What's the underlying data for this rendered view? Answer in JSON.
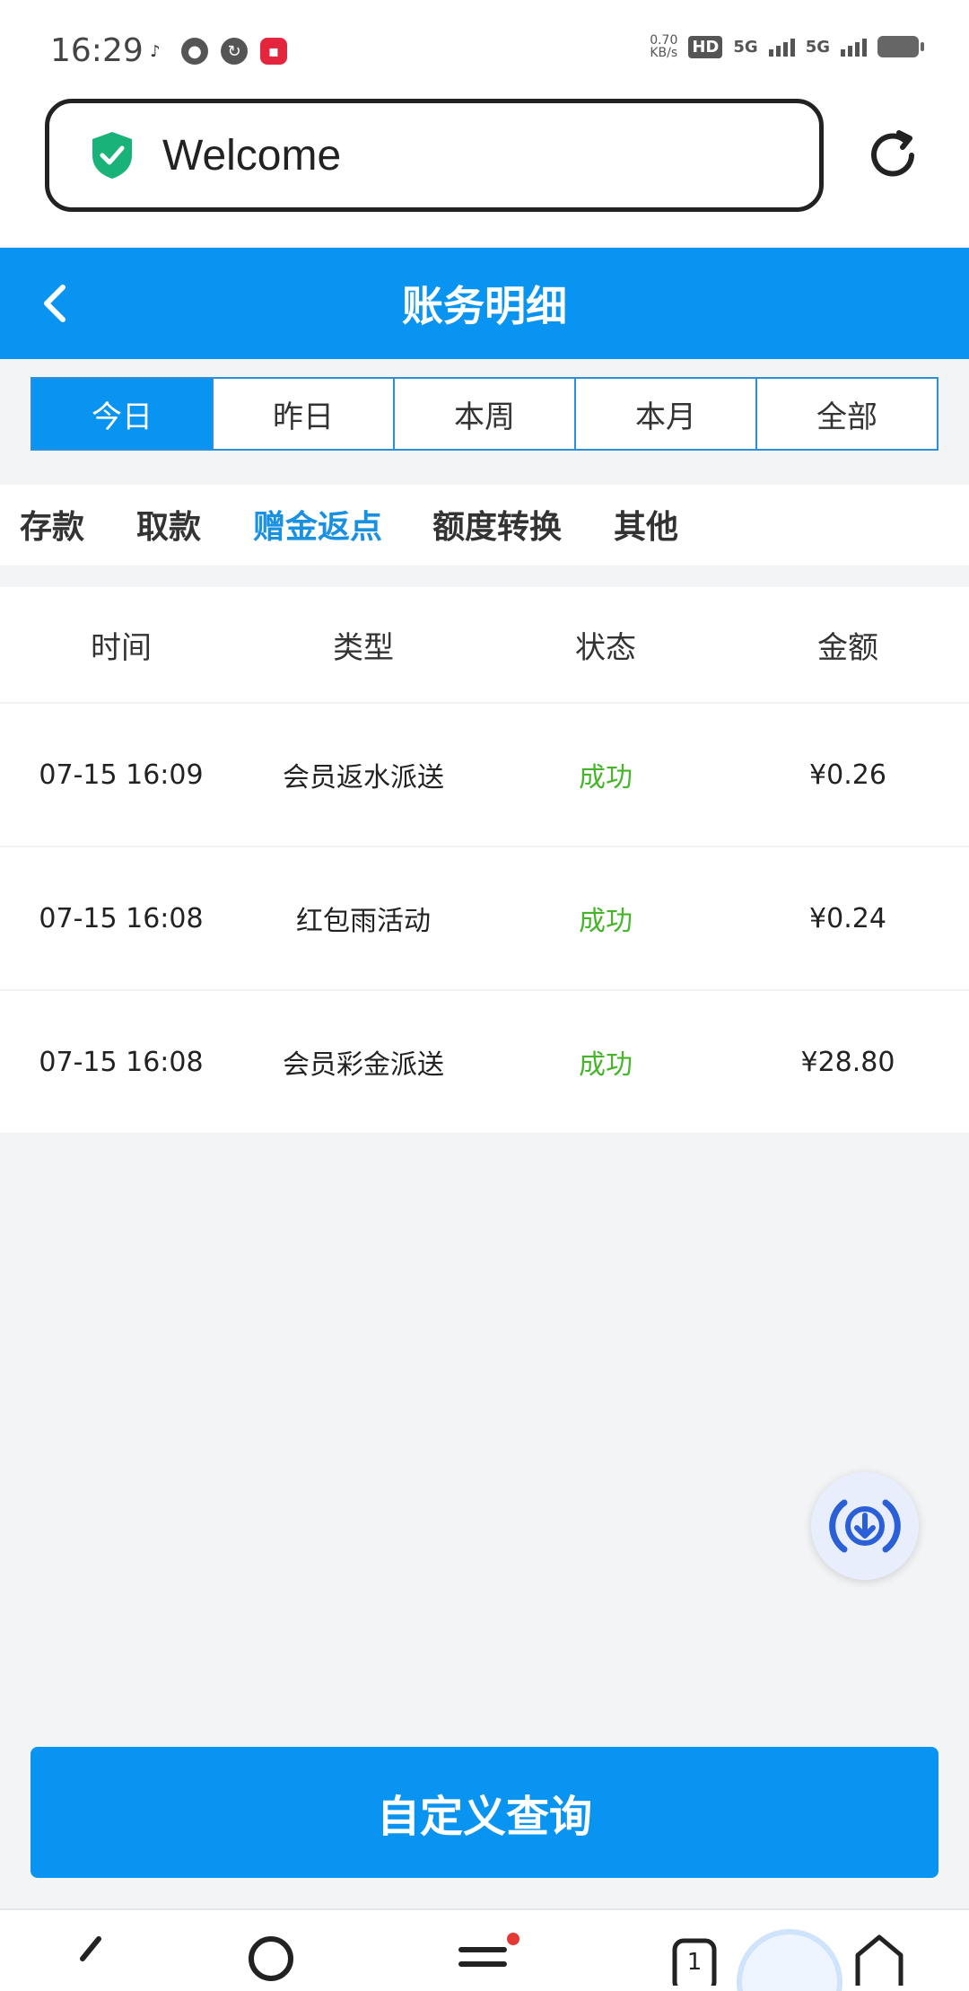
{
  "status_bar": {
    "time": "16:29",
    "speed_value": "0.70",
    "speed_unit": "KB/s",
    "hd": "HD",
    "net1": "5G",
    "net2": "5G"
  },
  "address_bar": {
    "text": "Welcome"
  },
  "header": {
    "title": "账务明细"
  },
  "date_tabs": [
    "今日",
    "昨日",
    "本周",
    "本月",
    "全部"
  ],
  "category_tabs": [
    "存款",
    "取款",
    "赠金返点",
    "额度转换",
    "其他"
  ],
  "table": {
    "headers": [
      "时间",
      "类型",
      "状态",
      "金额"
    ],
    "rows": [
      [
        "07-15 16:09",
        "会员返水派送",
        "成功",
        "¥0.26"
      ],
      [
        "07-15 16:08",
        "红包雨活动",
        "成功",
        "¥0.24"
      ],
      [
        "07-15 16:08",
        "会员彩金派送",
        "成功",
        "¥28.80"
      ]
    ]
  },
  "query_button": "自定义查询",
  "colors": {
    "primary": "#0994f2",
    "success": "#47b52a"
  }
}
